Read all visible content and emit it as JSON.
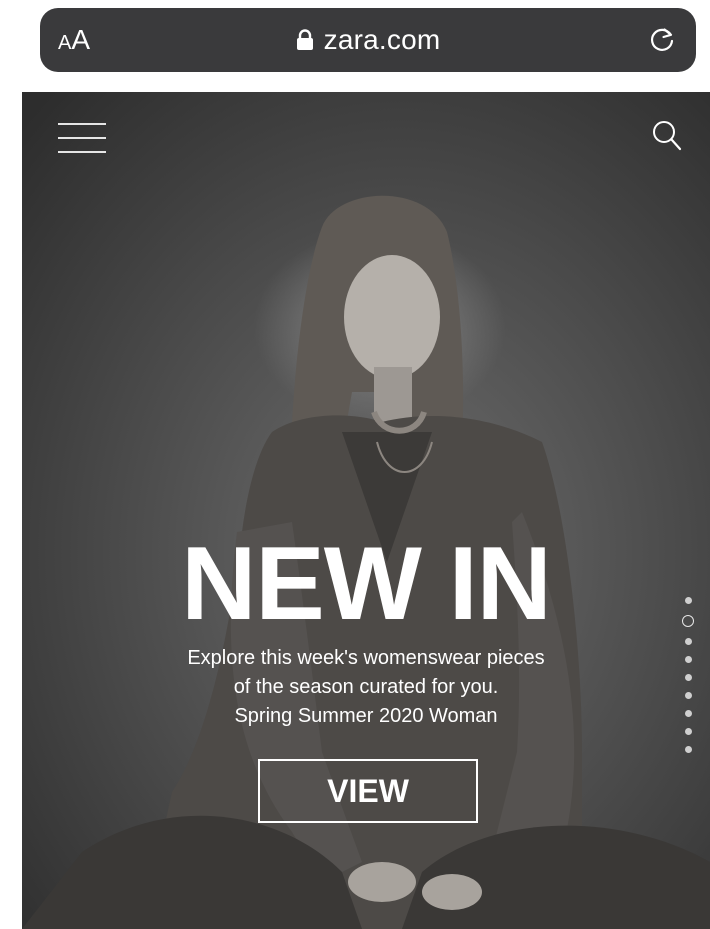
{
  "browser": {
    "text_size_small": "A",
    "text_size_large": "A",
    "url": "zara.com",
    "lock_icon": "lock-icon",
    "reload_icon": "reload-icon"
  },
  "hero": {
    "menu_icon": "hamburger-menu-icon",
    "search_icon": "search-icon",
    "headline": "NEW IN",
    "description_lines": [
      "Explore this week's womenswear pieces",
      "of the season curated for you.",
      "Spring Summer 2020 Woman"
    ],
    "cta_label": "VIEW",
    "slide_count": 9,
    "active_slide": 2
  },
  "colors": {
    "address_bar_bg": "#3a3a3c",
    "text": "#ffffff"
  }
}
